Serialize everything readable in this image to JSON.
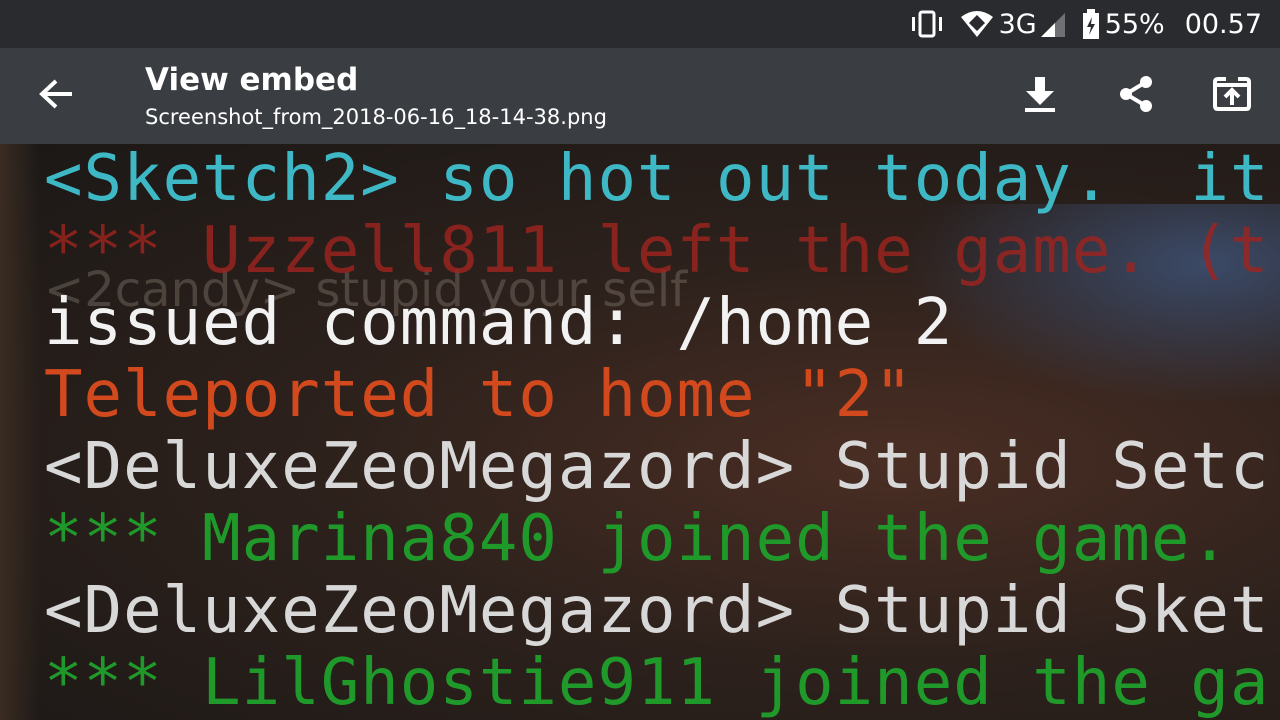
{
  "status_bar": {
    "network": "3G",
    "battery": "55%",
    "time": "00.57"
  },
  "app_bar": {
    "title": "View embed",
    "filename": "Screenshot_from_2018-06-16_18-14-38.png",
    "icons": [
      "back-arrow-icon",
      "download-icon",
      "share-icon",
      "open-external-icon"
    ]
  },
  "colors": {
    "status_bar_bg": "#2a2b2e",
    "app_bar_bg": "#3a3d42",
    "chat_cyan": "#3fb8c6",
    "chat_red": "#a0241f",
    "chat_white": "#f2f2f2",
    "chat_orange": "#d2491d",
    "chat_gray": "#d8d8d8",
    "chat_green": "#1f9a2a"
  },
  "chat": {
    "lines": [
      "<Sketch2> so hot out today.  it",
      "*** Uzzell811 left the game. (t",
      "issued command: /home 2",
      "Teleported to home \"2\"",
      "<DeluxeZeoMegazord> Stupid Setc",
      "*** Marina840 joined the game.",
      "<DeluxeZeoMegazord> Stupid Sket",
      "*** LilGhostie911 joined the ga"
    ],
    "ghost_text": "<2candy> stupid your self"
  }
}
